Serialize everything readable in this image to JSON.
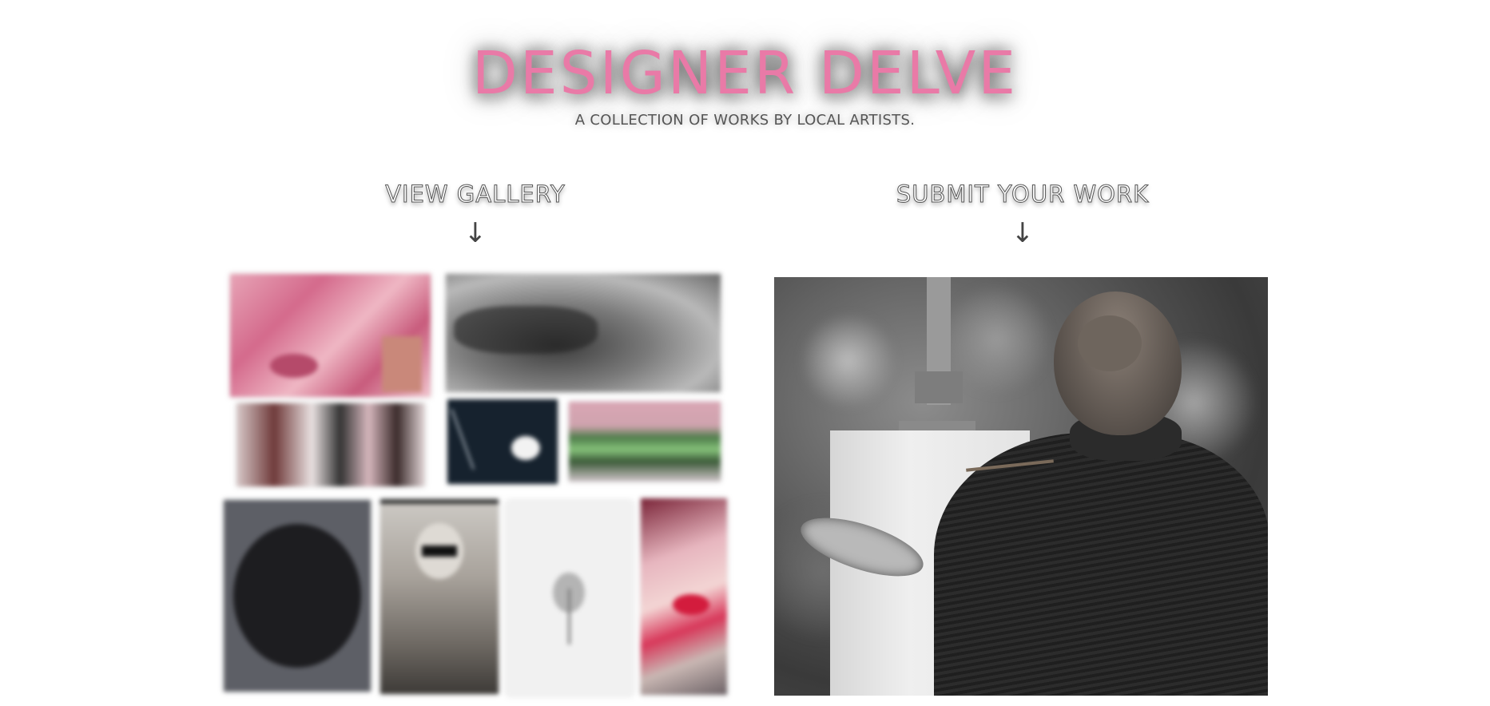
{
  "header": {
    "title": "DESIGNER DELVE",
    "subtitle": "A COLLECTION OF WORKS BY LOCAL ARTISTS."
  },
  "sections": {
    "gallery": {
      "label": "VIEW GALLERY",
      "arrow": "↓"
    },
    "submit": {
      "label": "SUBMIT YOUR WORK",
      "arrow": "↓"
    }
  },
  "colors": {
    "title": "#e97aa7",
    "text": "#555555",
    "background": "#ffffff"
  },
  "icons": {
    "arrow": "arrow-down-icon"
  }
}
